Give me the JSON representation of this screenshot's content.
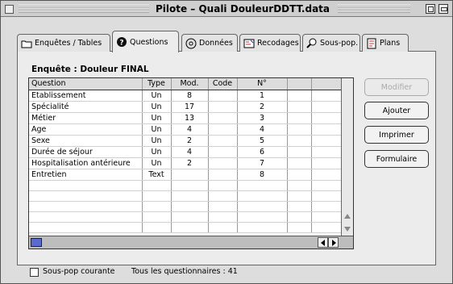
{
  "window": {
    "title": "Pilote – Quali DouleurDDTT.data"
  },
  "tabs": [
    {
      "label": "Enquêtes / Tables",
      "icon": "folder-icon"
    },
    {
      "label": "Questions",
      "icon": "question-icon"
    },
    {
      "label": "Données",
      "icon": "disk-icon"
    },
    {
      "label": "Recodages",
      "icon": "recode-icon"
    },
    {
      "label": "Sous-pop.",
      "icon": "magnifier-icon"
    },
    {
      "label": "Plans",
      "icon": "notepad-icon"
    }
  ],
  "enquete": {
    "label": "Enquête : Douleur FINAL"
  },
  "table": {
    "headers": [
      "Question",
      "Type",
      "Mod.",
      "Code",
      "N°"
    ],
    "rows": [
      {
        "question": "Etablissement",
        "type": "Un",
        "mod": "8",
        "code": "",
        "num": "1"
      },
      {
        "question": "Spécialité",
        "type": "Un",
        "mod": "17",
        "code": "",
        "num": "2"
      },
      {
        "question": "Métier",
        "type": "Un",
        "mod": "13",
        "code": "",
        "num": "3"
      },
      {
        "question": "Age",
        "type": "Un",
        "mod": "4",
        "code": "",
        "num": "4"
      },
      {
        "question": "Sexe",
        "type": "Un",
        "mod": "2",
        "code": "",
        "num": "5"
      },
      {
        "question": "Durée de séjour",
        "type": "Un",
        "mod": "4",
        "code": "",
        "num": "6"
      },
      {
        "question": "Hospitalisation antérieure",
        "type": "Un",
        "mod": "2",
        "code": "",
        "num": "7"
      },
      {
        "question": "Entretien",
        "type": "Text",
        "mod": "",
        "code": "",
        "num": "8"
      }
    ]
  },
  "buttons": {
    "modifier": "Modifier",
    "ajouter": "Ajouter",
    "imprimer": "Imprimer",
    "formulaire": "Formulaire"
  },
  "footer": {
    "checkbox_label": "Sous-pop courante",
    "status": "Tous les questionnaires : 41"
  }
}
